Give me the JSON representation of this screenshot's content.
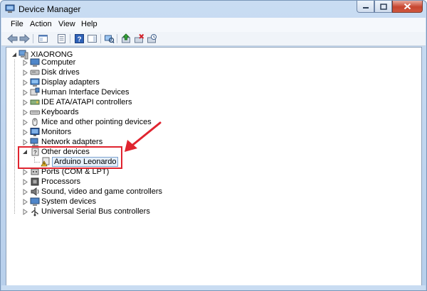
{
  "window": {
    "title": "Device Manager"
  },
  "menu": {
    "items": [
      "File",
      "Action",
      "View",
      "Help"
    ]
  },
  "toolbar": {
    "buttons": [
      "back-arrow-icon",
      "forward-arrow-icon",
      "show-hide-console-tree-icon",
      "properties-icon",
      "help-icon",
      "action-pane-icon",
      "scan-hardware-icon",
      "update-driver-icon",
      "uninstall-icon",
      "disable-device-icon"
    ]
  },
  "tree": {
    "root": {
      "label": "XIAORONG",
      "icon": "computer-root-icon"
    },
    "items": [
      {
        "label": "Computer",
        "icon": "computer-icon"
      },
      {
        "label": "Disk drives",
        "icon": "disk-drive-icon"
      },
      {
        "label": "Display adapters",
        "icon": "display-adapter-icon"
      },
      {
        "label": "Human Interface Devices",
        "icon": "hid-icon"
      },
      {
        "label": "IDE ATA/ATAPI controllers",
        "icon": "ide-controller-icon"
      },
      {
        "label": "Keyboards",
        "icon": "keyboard-icon"
      },
      {
        "label": "Mice and other pointing devices",
        "icon": "mouse-icon"
      },
      {
        "label": "Monitors",
        "icon": "monitor-icon"
      },
      {
        "label": "Network adapters",
        "icon": "network-adapter-icon"
      },
      {
        "label": "Other devices",
        "icon": "other-devices-icon",
        "expanded": true,
        "children": [
          {
            "label": "Arduino Leonardo",
            "icon": "warning-device-icon"
          }
        ]
      },
      {
        "label": "Ports (COM & LPT)",
        "icon": "port-icon"
      },
      {
        "label": "Processors",
        "icon": "processor-icon"
      },
      {
        "label": "Sound, video and game controllers",
        "icon": "sound-icon"
      },
      {
        "label": "System devices",
        "icon": "system-devices-icon"
      },
      {
        "label": "Universal Serial Bus controllers",
        "icon": "usb-icon"
      }
    ]
  },
  "annotation": {
    "color": "#e0242f"
  }
}
